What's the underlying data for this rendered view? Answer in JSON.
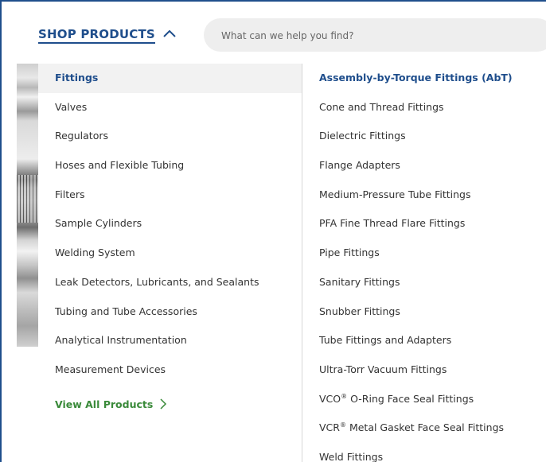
{
  "header": {
    "shop_label": "SHOP PRODUCTS",
    "search_placeholder": "What can we help you find?"
  },
  "categories": [
    {
      "label": "Fittings",
      "active": true
    },
    {
      "label": "Valves"
    },
    {
      "label": "Regulators"
    },
    {
      "label": "Hoses and Flexible Tubing"
    },
    {
      "label": "Filters"
    },
    {
      "label": "Sample Cylinders"
    },
    {
      "label": "Welding System"
    },
    {
      "label": "Leak Detectors, Lubricants, and Sealants"
    },
    {
      "label": "Tubing and Tube Accessories"
    },
    {
      "label": "Analytical Instrumentation"
    },
    {
      "label": "Measurement Devices"
    }
  ],
  "view_all_label": "View All Products",
  "subcategories": [
    {
      "label": "Assembly-by-Torque Fittings (AbT)",
      "active": true
    },
    {
      "label": "Cone and Thread Fittings"
    },
    {
      "label": "Dielectric Fittings"
    },
    {
      "label": "Flange Adapters"
    },
    {
      "label": "Medium-Pressure Tube Fittings"
    },
    {
      "label": "PFA Fine Thread Flare Fittings"
    },
    {
      "label": "Pipe Fittings"
    },
    {
      "label": "Sanitary Fittings"
    },
    {
      "label": "Snubber Fittings"
    },
    {
      "label": "Tube Fittings and Adapters"
    },
    {
      "label": "Ultra-Torr Vacuum Fittings"
    },
    {
      "label": "VCO",
      "sup": "®",
      "rest": " O-Ring Face Seal Fittings"
    },
    {
      "label": "VCR",
      "sup": "®",
      "rest": " Metal Gasket Face Seal Fittings"
    },
    {
      "label": "Weld Fittings"
    }
  ],
  "colors": {
    "brand_blue": "#1f4e8c",
    "link_green": "#3a8a3a",
    "active_bg": "#f2f2f2",
    "text": "#333333"
  },
  "icons": {
    "collapse": "chevron-up-icon",
    "view_all": "chevron-right-icon"
  }
}
